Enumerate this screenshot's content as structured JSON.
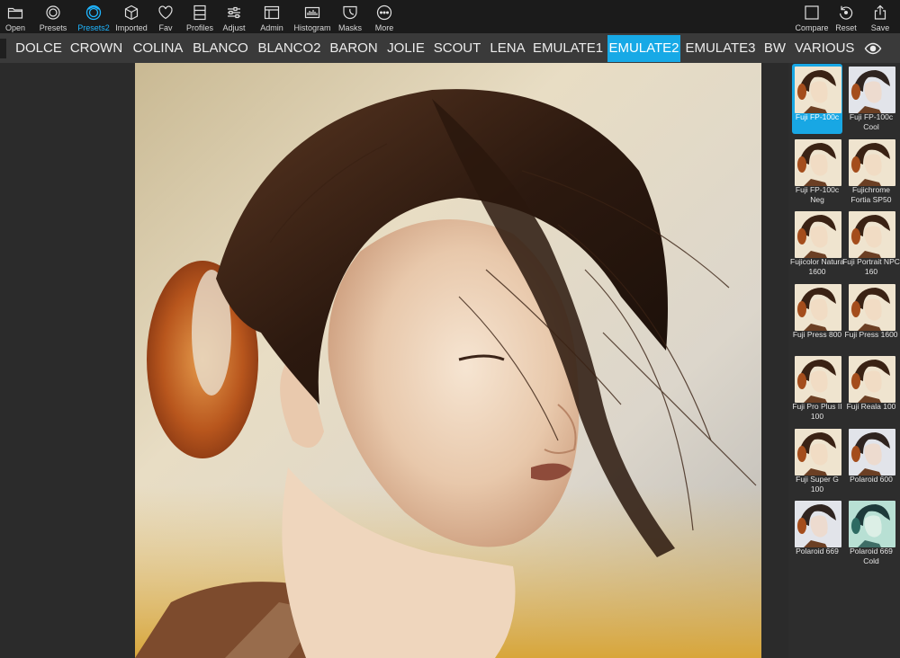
{
  "toolbar": {
    "left_tools": [
      {
        "label": "Open",
        "icon": "folder-icon"
      },
      {
        "label": "Presets",
        "icon": "presets-icon"
      },
      {
        "label": "Presets2",
        "icon": "presets2-icon",
        "active": true
      },
      {
        "label": "Imported",
        "icon": "cube-icon"
      },
      {
        "label": "Fav",
        "icon": "heart-icon"
      },
      {
        "label": "Profiles",
        "icon": "profiles-icon"
      },
      {
        "label": "Adjust",
        "icon": "sliders-icon"
      },
      {
        "label": "Admin",
        "icon": "admin-icon"
      },
      {
        "label": "Histogram",
        "icon": "histogram-icon"
      },
      {
        "label": "Masks",
        "icon": "mask-icon"
      },
      {
        "label": "More",
        "icon": "more-icon"
      }
    ],
    "right_tools": [
      {
        "label": "Compare",
        "icon": "compare-icon"
      },
      {
        "label": "Reset",
        "icon": "reset-icon"
      },
      {
        "label": "Save",
        "icon": "share-icon"
      }
    ],
    "accent_color": "#1fb6ff"
  },
  "categories": {
    "items": [
      "DOLCE",
      "CROWN",
      "COLINA",
      "BLANCO",
      "BLANCO2",
      "BARON",
      "JOLIE",
      "SCOUT",
      "LENA",
      "EMULATE1",
      "EMULATE2",
      "EMULATE3",
      "BW",
      "VARIOUS"
    ],
    "selected": "EMULATE2",
    "toggle_icon": "eye-icon"
  },
  "presets": {
    "items": [
      {
        "name": "Fuji FP-100c",
        "tone": "warm",
        "selected": true
      },
      {
        "name": "Fuji FP-100c Cool",
        "tone": "cool"
      },
      {
        "name": "Fuji FP-100c Neg",
        "tone": "warm"
      },
      {
        "name": "Fujichrome Fortia SP50",
        "tone": "warm"
      },
      {
        "name": "Fujicolor Natura 1600",
        "tone": "warm"
      },
      {
        "name": "Fuji Portrait NPC 160",
        "tone": "warm"
      },
      {
        "name": "Fuji Press 800",
        "tone": "warm"
      },
      {
        "name": "Fuji Press 1600",
        "tone": "warm"
      },
      {
        "name": "Fuji Pro Plus II 100",
        "tone": "warm"
      },
      {
        "name": "Fuji Reala 100",
        "tone": "warm"
      },
      {
        "name": "Fuji Super G 100",
        "tone": "warm"
      },
      {
        "name": "Polaroid 600",
        "tone": "cool"
      },
      {
        "name": "Polaroid 669",
        "tone": "cool"
      },
      {
        "name": "Polaroid 669 Cold",
        "tone": "teal"
      }
    ],
    "selection_color": "#18a7e4"
  }
}
